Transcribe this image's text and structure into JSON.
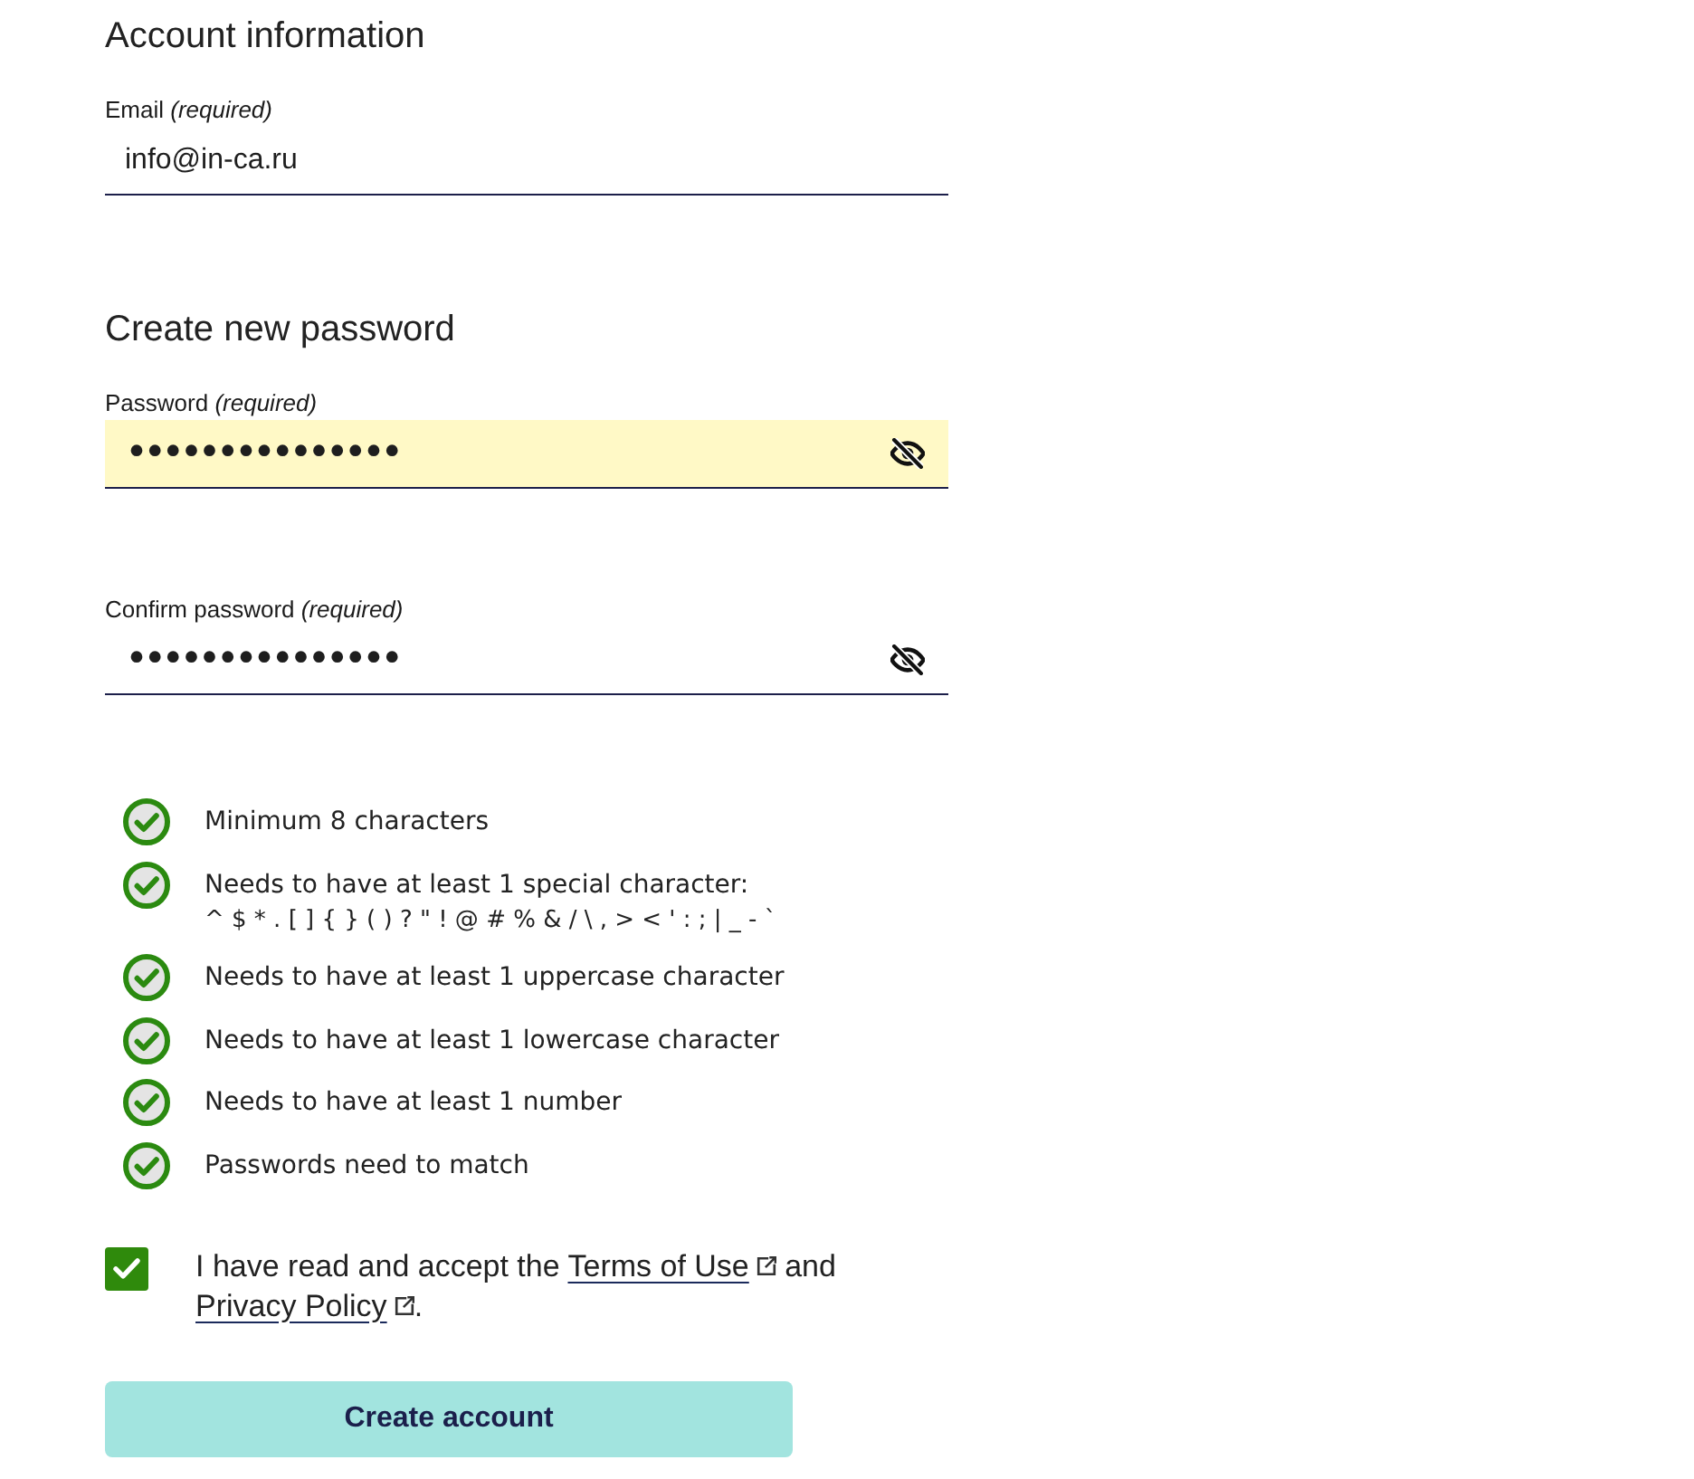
{
  "sections": [
    {
      "heading": "Account information",
      "fields": [
        {
          "kind": "text",
          "label": "Email *(required)*",
          "value": "info@in-ca.ru",
          "highlighted": false
        }
      ]
    },
    {
      "heading": "Create new password",
      "fields": [
        {
          "kind": "password",
          "label": "Password *(required)*",
          "value": "•••••••••••••••",
          "highlighted": true
        },
        {
          "kind": "password",
          "label": "Confirm password *(required)*",
          "value": "•••••••••••••••",
          "highlighted": false
        }
      ]
    }
  ],
  "requirements": [
    {
      "text": "Minimum 8 characters",
      "met": true
    },
    {
      "text": "Needs to have at least 1 special character:",
      "detail": "^ $ * . [ ] { } ( ) ? \" ! @ # % & / \\ , > < ' : ; | _ - `",
      "met": true
    },
    {
      "text": "Needs to have at least 1 uppercase character",
      "met": true
    },
    {
      "text": "Needs to have at least 1 lowercase character",
      "met": true
    },
    {
      "text": "Needs to have at least 1 number",
      "met": true
    },
    {
      "text": "Passwords need to match",
      "met": true
    }
  ],
  "terms": {
    "checked": true,
    "parts": [
      {
        "kind": "text",
        "text": "I have read and accept the "
      },
      {
        "kind": "link",
        "text": "Terms of Use"
      },
      {
        "kind": "text",
        "text": " and "
      },
      {
        "kind": "link",
        "text": "Privacy Policy"
      },
      {
        "kind": "text",
        "text": "."
      }
    ]
  },
  "submit_button": {
    "label": "Create account"
  }
}
